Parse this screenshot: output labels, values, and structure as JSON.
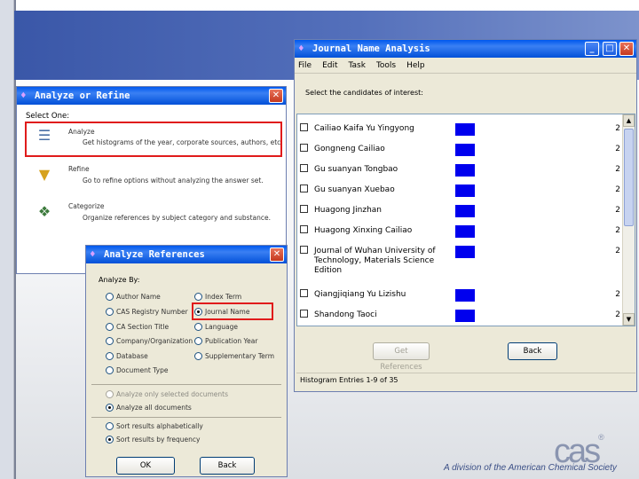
{
  "footer": {
    "text": "A division of the American Chemical Society"
  },
  "logo": {
    "text": "cas",
    "trademark": "®"
  },
  "refine_window": {
    "title": "Analyze or Refine",
    "select_label": "Select One:",
    "options": [
      {
        "title": "Analyze",
        "desc": "Get histograms of the year, corporate sources, authors, etc",
        "icon": "bar-chart-icon"
      },
      {
        "title": "Refine",
        "desc": "Go to refine options without analyzing the answer set.",
        "icon": "funnel-icon"
      },
      {
        "title": "Categorize",
        "desc": "Organize references by subject category and substance.",
        "icon": "categorize-icon"
      }
    ]
  },
  "journal_window": {
    "title": "Journal Name Analysis",
    "menu": [
      "File",
      "Edit",
      "Task",
      "Tools",
      "Help"
    ],
    "prompt": "Select the candidates of interest:",
    "rows": [
      {
        "name": "Cailiao Kaifa Yu Yingyong",
        "count": "2"
      },
      {
        "name": "Gongneng Cailiao",
        "count": "2"
      },
      {
        "name": "Gu suanyan Tongbao",
        "count": "2"
      },
      {
        "name": "Gu suanyan Xuebao",
        "count": "2"
      },
      {
        "name": "Huagong Jinzhan",
        "count": "2"
      },
      {
        "name": "Huagong Xinxing Cailiao",
        "count": "2"
      },
      {
        "name": "Journal of Wuhan University of Technology, Materials Science Edition",
        "count": "2"
      },
      {
        "name": "Qiangjiqiang Yu Lizishu",
        "count": "2"
      },
      {
        "name": "Shandong Taoci",
        "count": "2"
      }
    ],
    "get_button": "Get References",
    "back_button": "Back",
    "status": "Histogram Entries 1-9 of 35",
    "bar_color": "#0000ee"
  },
  "ref_window": {
    "title": "Analyze References",
    "analyze_by": "Analyze By:",
    "left_options": [
      "Author Name",
      "CAS Registry Number",
      "CA Section Title",
      "Company/Organization",
      "Database",
      "Document Type"
    ],
    "right_options": [
      "Index Term",
      "Journal Name",
      "Language",
      "Publication Year",
      "Supplementary Term"
    ],
    "scope_options": [
      "Analyze only selected documents",
      "Analyze all documents"
    ],
    "sort_options": [
      "Sort results alphabetically",
      "Sort results by frequency"
    ],
    "ok_button": "OK",
    "back_button": "Back"
  }
}
